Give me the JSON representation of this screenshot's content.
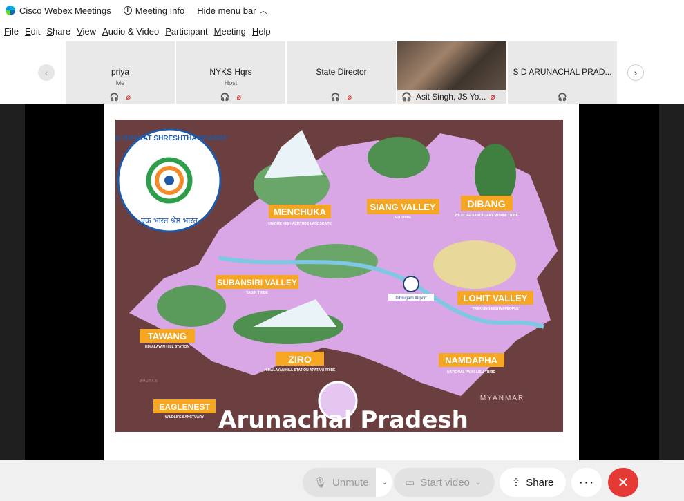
{
  "titlebar": {
    "app_title": "Cisco Webex Meetings",
    "meeting_info": "Meeting Info",
    "hide_menu_bar": "Hide menu bar"
  },
  "menubar": {
    "items": [
      {
        "u": "F",
        "rest": "ile"
      },
      {
        "u": "E",
        "rest": "dit"
      },
      {
        "u": "S",
        "rest": "hare"
      },
      {
        "u": "V",
        "rest": "iew"
      },
      {
        "u": "A",
        "rest": "udio & Video"
      },
      {
        "u": "P",
        "rest": "articipant"
      },
      {
        "u": "M",
        "rest": "eeting"
      },
      {
        "u": "H",
        "rest": "elp"
      }
    ]
  },
  "participants": [
    {
      "name": "priya",
      "sub": "Me"
    },
    {
      "name": "NYKS Hqrs",
      "sub": "Host"
    },
    {
      "name": "State Director",
      "sub": ""
    },
    {
      "name": "Asit Singh, JS Yo..."
    },
    {
      "name": "S D ARUNACHAL PRAD..."
    }
  ],
  "slide": {
    "logo_text": "EK BHARAT SHRESHTHA BHARAT",
    "logo_hindi": "एक भारत श्रेष्ठ भारत",
    "title": "Arunachal Pradesh",
    "places": [
      {
        "name": "MENCHUKA",
        "sub": "UNIQUE HIGH ALTITUDE LANDSCAPE"
      },
      {
        "name": "SIANG VALLEY",
        "sub": "ADI TRIBE"
      },
      {
        "name": "DIBANG",
        "sub": "WILDLIFE SANCTUARY MISHMI TRIBE"
      },
      {
        "name": "SUBANSIRI VALLEY",
        "sub": "TAGIN TRIBE"
      },
      {
        "name": "LOHIT VALLEY",
        "sub": "TREKKING MISHMI PEOPLE"
      },
      {
        "name": "TAWANG",
        "sub": "HIMALAYAN HILL STATION"
      },
      {
        "name": "ZIRO",
        "sub": "HIMALAYAN HILL STATION APATANI TRIBE"
      },
      {
        "name": "NAMDAPHA",
        "sub": "NATIONAL PARK LISU TRIBE"
      },
      {
        "name": "EAGLENEST",
        "sub": "WILDLIFE SANCTUARY"
      }
    ],
    "airport": "Dibrugarh Airport",
    "neighbor": "MYANMAR",
    "neighbor2": "BHUTAN"
  },
  "controls": {
    "unmute": "Unmute",
    "start_video": "Start video",
    "share": "Share",
    "more": "···",
    "leave": "✕"
  }
}
